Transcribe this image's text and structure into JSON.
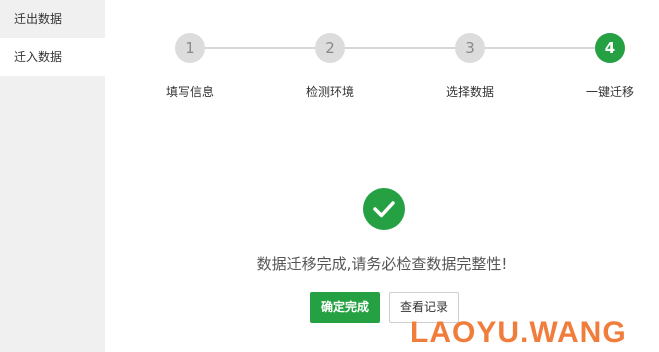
{
  "sidebar": {
    "items": [
      {
        "label": "迁出数据"
      },
      {
        "label": "迁入数据"
      }
    ]
  },
  "steps": [
    {
      "number": "1",
      "label": "填写信息"
    },
    {
      "number": "2",
      "label": "检测环境"
    },
    {
      "number": "3",
      "label": "选择数据"
    },
    {
      "number": "4",
      "label": "一键迁移"
    }
  ],
  "result": {
    "message": "数据迁移完成,请务必检查数据完整性!"
  },
  "actions": {
    "confirm_label": "确定完成",
    "view_log_label": "查看记录"
  },
  "watermark": "LAOYU.WANG",
  "colors": {
    "accent": "#25a143",
    "inactive_step": "#dcdcdc",
    "watermark": "#f07d3c"
  }
}
